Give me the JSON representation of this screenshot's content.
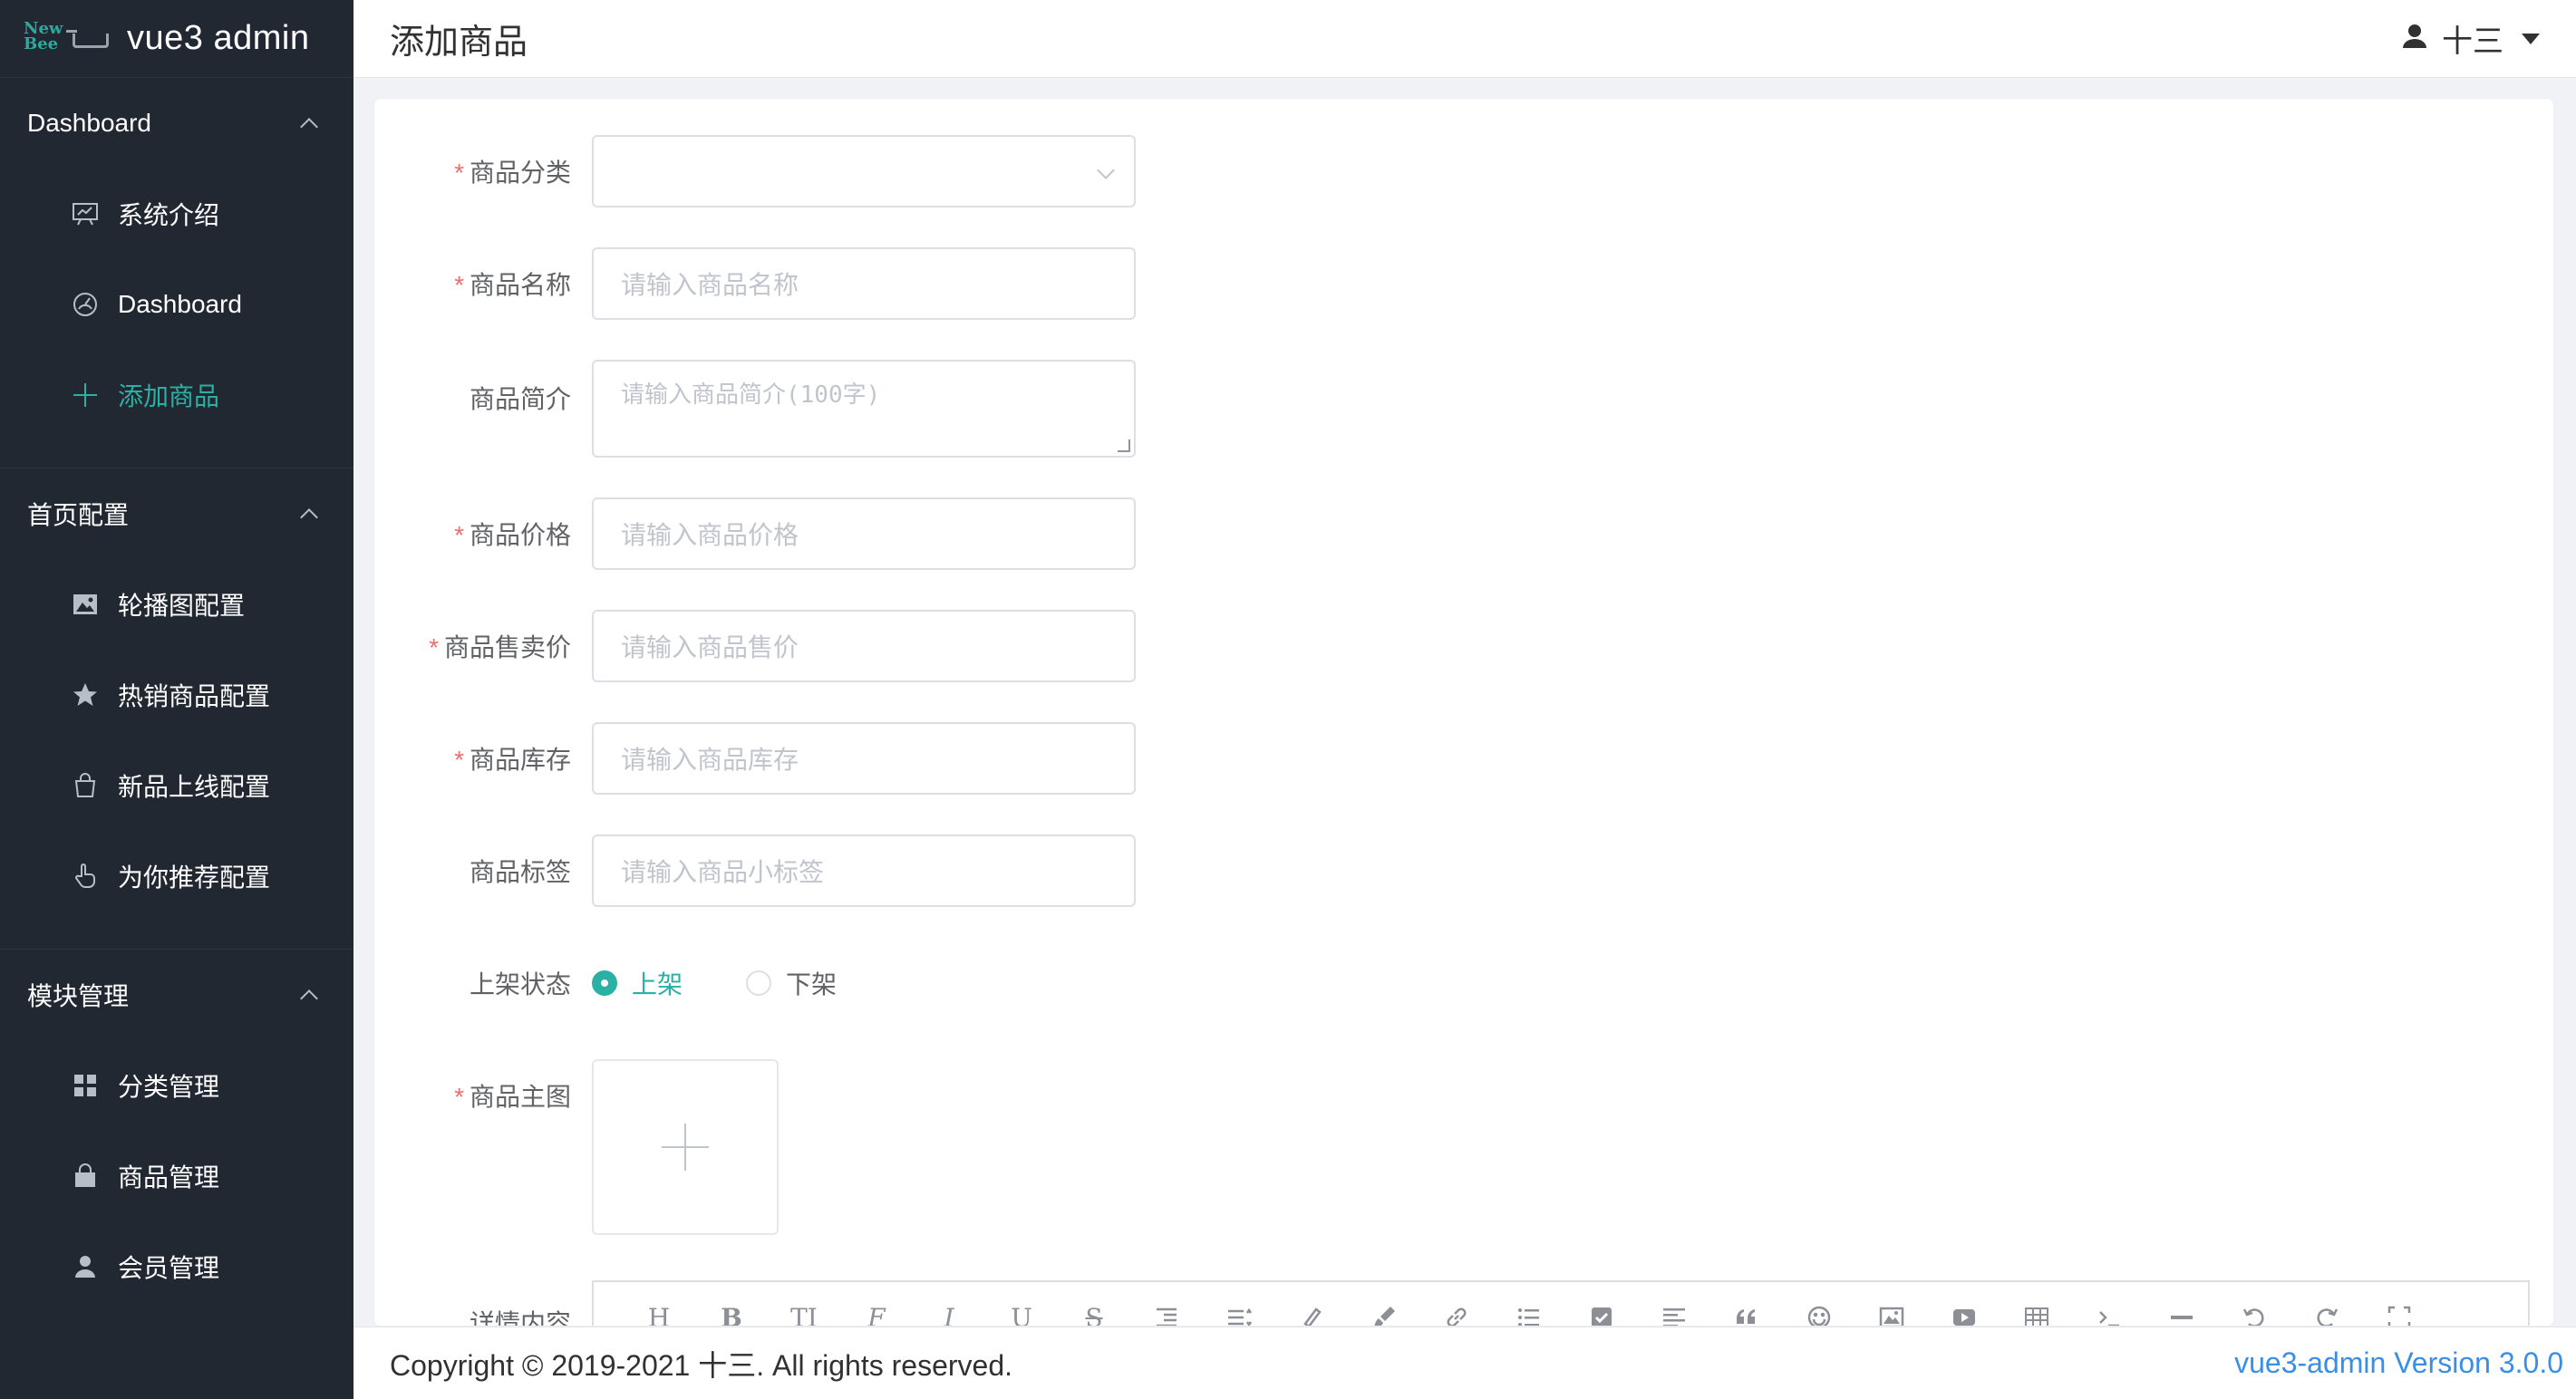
{
  "app": {
    "title": "vue3 admin",
    "logo_text_top": "New",
    "logo_text_bottom": "Bee"
  },
  "header": {
    "page_title": "添加商品",
    "user_name": "十三"
  },
  "sidebar": {
    "groups": [
      {
        "label": "Dashboard",
        "items": [
          {
            "label": "系统介绍",
            "icon": "chart-board-icon"
          },
          {
            "label": "Dashboard",
            "icon": "odometer-icon"
          },
          {
            "label": "添加商品",
            "icon": "plus-icon",
            "active": true
          }
        ]
      },
      {
        "label": "首页配置",
        "items": [
          {
            "label": "轮播图配置",
            "icon": "picture-icon"
          },
          {
            "label": "热销商品配置",
            "icon": "star-icon"
          },
          {
            "label": "新品上线配置",
            "icon": "shopping-bag-icon"
          },
          {
            "label": "为你推荐配置",
            "icon": "pointer-icon"
          }
        ]
      },
      {
        "label": "模块管理",
        "items": [
          {
            "label": "分类管理",
            "icon": "grid-icon"
          },
          {
            "label": "商品管理",
            "icon": "goods-icon"
          },
          {
            "label": "会员管理",
            "icon": "user-icon"
          }
        ]
      }
    ]
  },
  "form": {
    "category": {
      "label": "商品分类",
      "value": ""
    },
    "name": {
      "label": "商品名称",
      "placeholder": "请输入商品名称"
    },
    "intro": {
      "label": "商品简介",
      "placeholder": "请输入商品简介(100字)"
    },
    "price": {
      "label": "商品价格",
      "placeholder": "请输入商品价格"
    },
    "selling_price": {
      "label": "商品售卖价",
      "placeholder": "请输入商品售价"
    },
    "stock": {
      "label": "商品库存",
      "placeholder": "请输入商品库存"
    },
    "tag": {
      "label": "商品标签",
      "placeholder": "请输入商品小标签"
    },
    "status": {
      "label": "上架状态",
      "options": [
        "上架",
        "下架"
      ],
      "selected": "上架"
    },
    "main_image": {
      "label": "商品主图"
    },
    "detail": {
      "label": "详情内容"
    }
  },
  "editor_toolbar": [
    "heading-icon",
    "bold-icon",
    "font-size-icon",
    "font-family-icon",
    "italic-icon",
    "underline-icon",
    "strikethrough-icon",
    "indent-icon",
    "line-height-icon",
    "clear-format-icon",
    "brush-icon",
    "link-icon",
    "bulleted-list-icon",
    "todo-icon",
    "align-icon",
    "quote-icon",
    "emoji-icon",
    "image-icon",
    "video-icon",
    "table-icon",
    "code-icon",
    "divider-icon",
    "undo-icon",
    "redo-icon",
    "fullscreen-icon"
  ],
  "editor_glyphs": {
    "heading": "H",
    "bold": "B",
    "font_size": "TI",
    "font_family": "F",
    "italic": "I",
    "underline": "U",
    "strike": "S"
  },
  "footer": {
    "copyright": "Copyright © 2019-2021 十三. All rights reserved.",
    "version": "vue3-admin Version 3.0.0"
  },
  "colors": {
    "sidebar_bg": "#222832",
    "accent": "#2ab0a4",
    "required": "#f56c6c",
    "version_link": "#3a8ee6"
  }
}
